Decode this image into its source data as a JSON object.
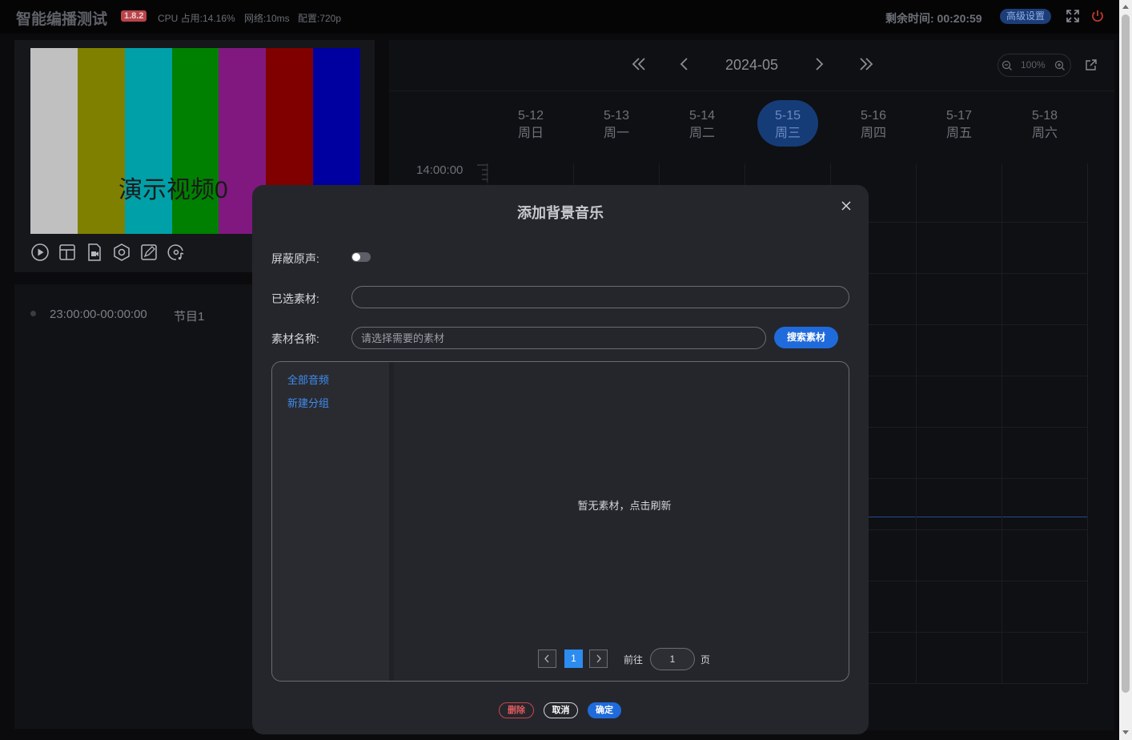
{
  "topbar": {
    "app_title": "智能编播测试",
    "version": "1.8.2",
    "cpu": "CPU 占用:14.16%",
    "network": "网络:10ms",
    "config": "配置:720p",
    "remaining": "剩余时间: 00:20:59",
    "advanced_label": "高级设置",
    "icons": [
      "fullscreen-icon",
      "power-icon"
    ],
    "power_color": "#c0392b"
  },
  "preview": {
    "video_label": "演示视频0",
    "bar_colors": [
      "#c0c0c0",
      "#808000",
      "#00a0a8",
      "#008000",
      "#801880",
      "#800000",
      "#0000a0"
    ],
    "controls": [
      "play-icon",
      "layout-icon",
      "camera-file-icon",
      "settings-hex-icon",
      "edit-icon",
      "music-disc-icon"
    ]
  },
  "program_list": {
    "items": [
      {
        "time": "23:00:00-00:00:00",
        "name": "节目1"
      }
    ]
  },
  "calendar": {
    "month": "2024-05",
    "zoom": "100%",
    "days": [
      {
        "date": "5-12",
        "weekday": "周日"
      },
      {
        "date": "5-13",
        "weekday": "周一"
      },
      {
        "date": "5-14",
        "weekday": "周二"
      },
      {
        "date": "5-15",
        "weekday": "周三"
      },
      {
        "date": "5-16",
        "weekday": "周四"
      },
      {
        "date": "5-17",
        "weekday": "周五"
      },
      {
        "date": "5-18",
        "weekday": "周六"
      }
    ],
    "active_day_index": 3,
    "time_label": "14:00:00"
  },
  "modal": {
    "title": "添加背景音乐",
    "mute_label": "屏蔽原声:",
    "mute_on": false,
    "selected_label": "已选素材:",
    "selected_value": "",
    "name_label": "素材名称:",
    "name_placeholder": "请选择需要的素材",
    "search_label": "搜索素材",
    "groups": [
      "全部音频",
      "新建分组"
    ],
    "empty_text": "暂无素材，点击刷新",
    "pager": {
      "current": "1",
      "goto_label": "前往",
      "goto_value": "1",
      "unit": "页"
    },
    "buttons": {
      "delete": "删除",
      "cancel": "取消",
      "ok": "确定"
    },
    "accent": "#1f6bdb",
    "danger": "#e05a5e"
  }
}
